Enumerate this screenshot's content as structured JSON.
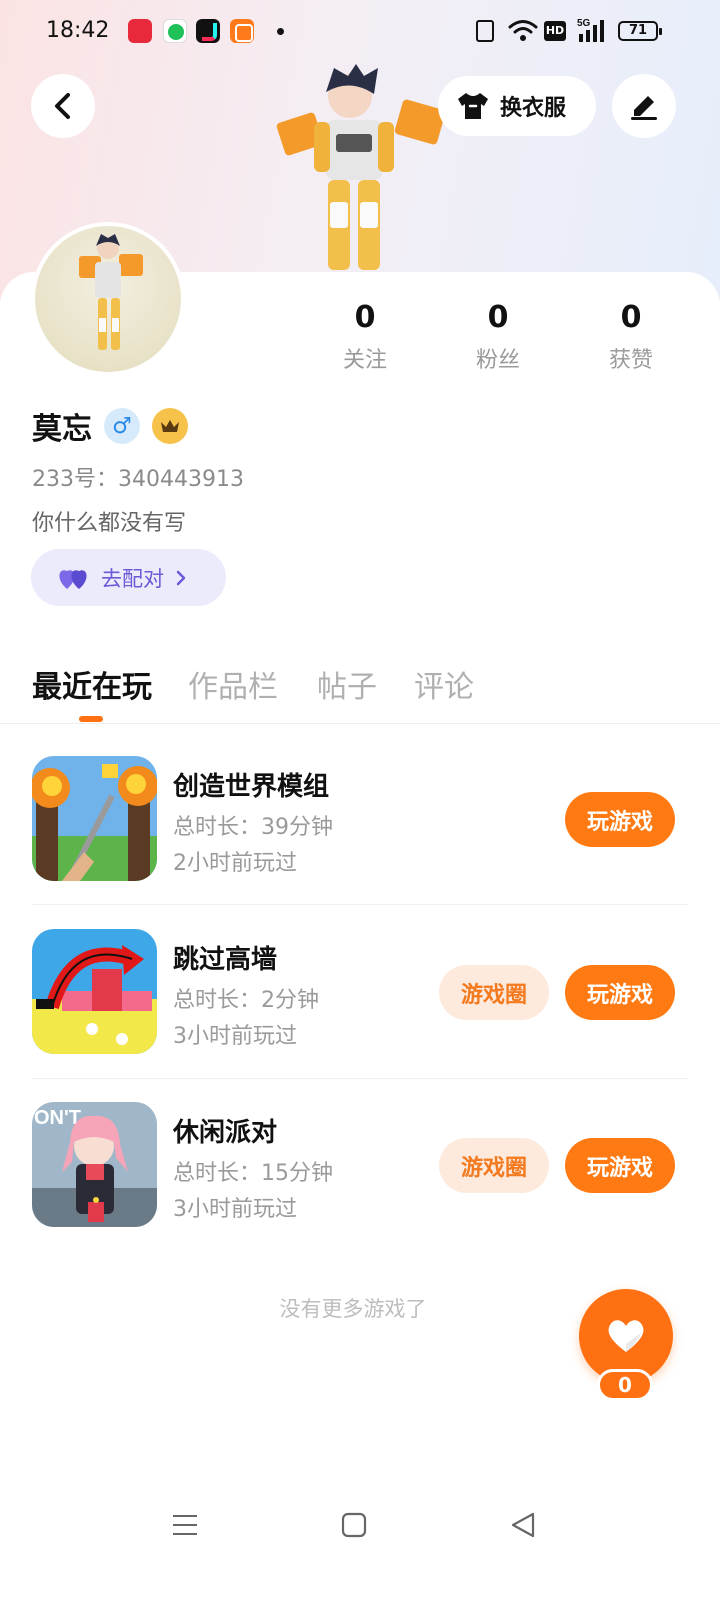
{
  "status_bar": {
    "time": "18:42",
    "notification_icons": [
      "xiaohongshu-icon",
      "wechat-pay-icon",
      "douyin-icon",
      "taobao-icon"
    ],
    "network_label": "5G",
    "hd_label": "HD",
    "battery_level": "71"
  },
  "header": {
    "outfit_label": "换衣服"
  },
  "profile": {
    "stats": [
      {
        "value": "0",
        "label": "关注"
      },
      {
        "value": "0",
        "label": "粉丝"
      },
      {
        "value": "0",
        "label": "获赞"
      }
    ],
    "name": "莫忘",
    "gender_symbol": "♂",
    "uid": "233号：340443913",
    "bio": "你什么都没有写",
    "match_label": "去配对"
  },
  "tabs": [
    "最近在玩",
    "作品栏",
    "帖子",
    "评论"
  ],
  "games": [
    {
      "title": "创造世界模组",
      "duration": "总时长：39分钟",
      "last_played": "2小时前玩过",
      "play_label": "玩游戏"
    },
    {
      "title": "跳过高墙",
      "duration": "总时长：2分钟",
      "last_played": "3小时前玩过",
      "play_label": "玩游戏",
      "circle_label": "游戏圈"
    },
    {
      "title": "休闲派对",
      "duration": "总时长：15分钟",
      "last_played": "3小时前玩过",
      "play_label": "玩游戏",
      "circle_label": "游戏圈"
    }
  ],
  "thumbnail_text": {
    "party": "ON'T"
  },
  "no_more_text": "没有更多游戏了",
  "like_count": "0",
  "colors": {
    "accent": "#ff7012",
    "match_text": "#6a5ad8",
    "pill_bg": "#fee9dd"
  }
}
